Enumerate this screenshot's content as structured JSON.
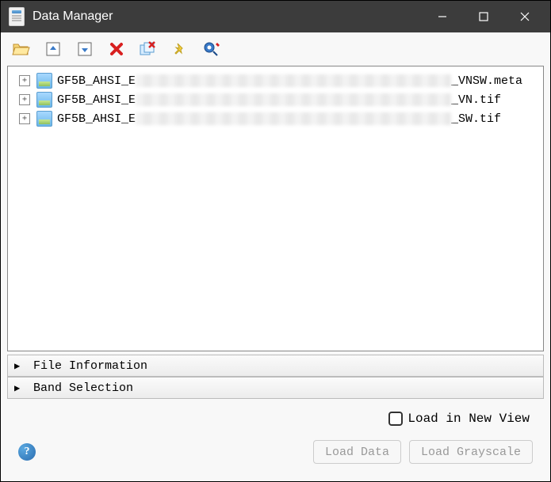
{
  "window": {
    "title": "Data Manager"
  },
  "toolbar": {
    "icons": [
      "open-folder",
      "collapse-up",
      "expand-down",
      "delete",
      "close-all",
      "pin",
      "pixel-locator"
    ]
  },
  "tree": {
    "items": [
      {
        "prefix": "GF5B_AHSI_E",
        "hidden_width": 398,
        "suffix": "_VNSW.meta"
      },
      {
        "prefix": "GF5B_AHSI_E",
        "hidden_width": 398,
        "suffix": "_VN.tif"
      },
      {
        "prefix": "GF5B_AHSI_E",
        "hidden_width": 398,
        "suffix": "_SW.tif"
      }
    ]
  },
  "accordion": {
    "sections": [
      {
        "label": "File Information"
      },
      {
        "label": "Band Selection"
      }
    ]
  },
  "footer": {
    "checkbox_label": "Load in New View",
    "checkbox_checked": false,
    "load_data_label": "Load Data",
    "load_grayscale_label": "Load Grayscale"
  }
}
